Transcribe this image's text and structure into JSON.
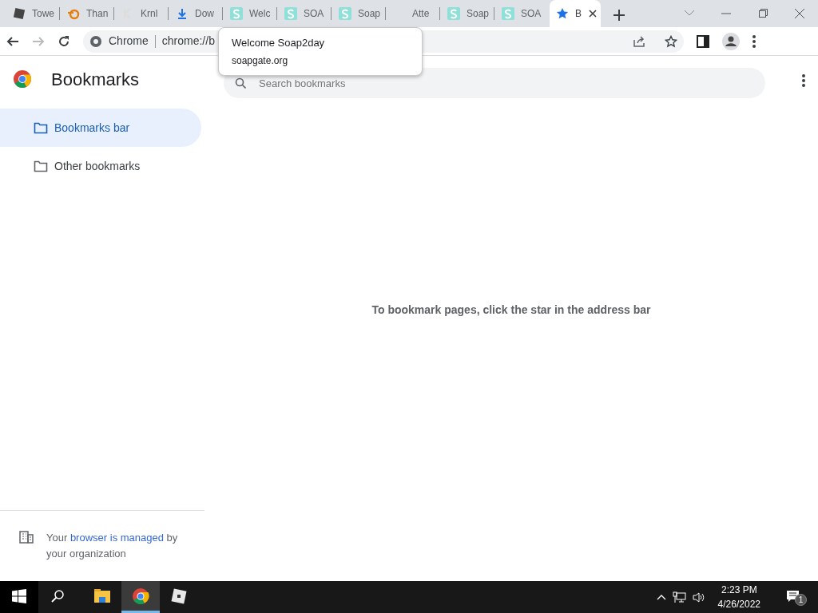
{
  "tabs": [
    {
      "kind": "roblox",
      "title": "Towe",
      "selected": false
    },
    {
      "kind": "blender",
      "title": "Than",
      "selected": false
    },
    {
      "kind": "krnl",
      "title": "Krnl",
      "selected": false
    },
    {
      "kind": "download",
      "title": "Dow",
      "selected": false
    },
    {
      "kind": "soap",
      "title": "Welc",
      "selected": false
    },
    {
      "kind": "soap",
      "title": "SOA",
      "selected": false
    },
    {
      "kind": "soap",
      "title": "Soap",
      "selected": false
    },
    {
      "kind": "none",
      "title": "Atte",
      "selected": false
    },
    {
      "kind": "soap",
      "title": "Soap",
      "selected": false
    },
    {
      "kind": "soap",
      "title": "SOA",
      "selected": false
    },
    {
      "kind": "star",
      "title": "B",
      "selected": true
    }
  ],
  "omnibox": {
    "chip": "Chrome",
    "url": "chrome://b"
  },
  "tooltip": {
    "title": "Welcome Soap2day",
    "url": "soapgate.org"
  },
  "page": {
    "title": "Bookmarks",
    "search": {
      "placeholder": "Search bookmarks"
    },
    "folders": [
      {
        "label": "Bookmarks bar",
        "selected": true
      },
      {
        "label": "Other bookmarks",
        "selected": false
      }
    ],
    "empty_message": "To bookmark pages, click the star in the address bar",
    "managed_notice": {
      "before": "Your ",
      "link": "browser is managed",
      "after": " by your organization"
    }
  },
  "taskbar": {
    "apps": [
      {
        "kind": "explorer",
        "selected": false
      },
      {
        "kind": "chrome",
        "selected": true
      },
      {
        "kind": "roblox",
        "selected": false
      }
    ],
    "time": "2:23 PM",
    "date": "4/26/2022",
    "notifications": "1"
  }
}
